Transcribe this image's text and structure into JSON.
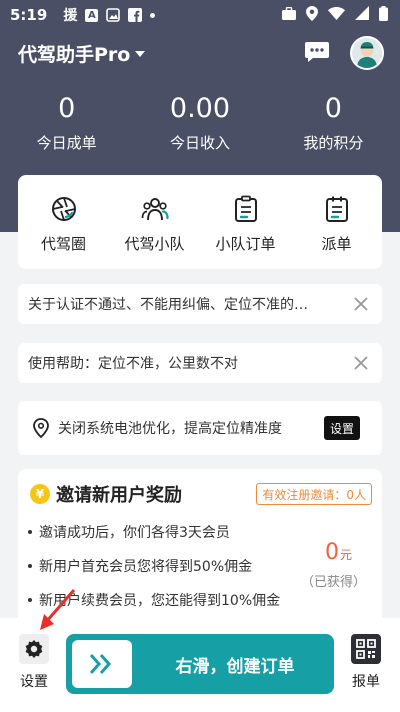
{
  "status_bar": {
    "time": "5:19",
    "notif_char": "援",
    "box_char": "A"
  },
  "header": {
    "title": "代驾助手Pro"
  },
  "stats": [
    {
      "value": "0",
      "label": "今日成单"
    },
    {
      "value": "0.00",
      "label": "今日收入"
    },
    {
      "value": "0",
      "label": "我的积分"
    }
  ],
  "nav": [
    {
      "label": "代驾圈",
      "icon": "aperture-icon"
    },
    {
      "label": "代驾小队",
      "icon": "team-icon"
    },
    {
      "label": "小队订单",
      "icon": "clipboard-icon"
    },
    {
      "label": "派单",
      "icon": "dispatch-icon"
    }
  ],
  "notices": [
    {
      "text": "关于认证不通过、不能用纠偏、定位不准的…"
    },
    {
      "text": "使用帮助：定位不准，公里数不对"
    }
  ],
  "location_tip": {
    "text": "关闭系统电池优化，提高定位精准度",
    "button": "设置"
  },
  "invite": {
    "coin": "¥",
    "title": "邀请新用户奖励",
    "badge": "有效注册邀请：0人",
    "bullets": [
      "邀请成功后，你们各得3天会员",
      "新用户首充会员您将得到50%佣金",
      "新用户续费会员，您还能得到10%佣金"
    ],
    "reward_value": "0",
    "reward_unit": "元",
    "reward_label": "（已获得）"
  },
  "bottom": {
    "settings_label": "设置",
    "slide_label": "右滑，创建订单",
    "report_label": "报单"
  },
  "colors": {
    "header": "#4a4f66",
    "accent": "#16a0a6",
    "orange": "#f08a3c"
  }
}
